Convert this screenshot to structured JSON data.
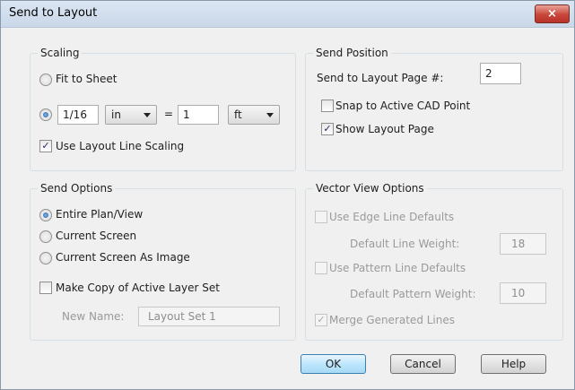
{
  "window": {
    "title": "Send to Layout",
    "close_glyph": "×"
  },
  "scaling": {
    "legend": "Scaling",
    "fit_to_sheet": "Fit to Sheet",
    "scale_left": "1/16",
    "left_unit": "in",
    "equals": "=",
    "scale_right": "1",
    "right_unit": "ft",
    "use_layout_line_scaling": "Use Layout Line Scaling"
  },
  "send_position": {
    "legend": "Send Position",
    "page_label": "Send to Layout Page #:",
    "page_value": "2",
    "snap_label": "Snap to Active CAD Point",
    "show_layout_label": "Show Layout Page"
  },
  "send_options": {
    "legend": "Send Options",
    "entire_plan": "Entire Plan/View",
    "current_screen": "Current Screen",
    "current_screen_image": "Current Screen As Image",
    "make_copy": "Make Copy of Active Layer Set",
    "new_name_label": "New Name:",
    "new_name_value": "Layout Set 1"
  },
  "vector_view": {
    "legend": "Vector View Options",
    "edge_defaults": "Use Edge Line Defaults",
    "default_line_weight_label": "Default Line Weight:",
    "default_line_weight": "18",
    "pattern_defaults": "Use Pattern Line Defaults",
    "default_pattern_weight_label": "Default Pattern Weight:",
    "default_pattern_weight": "10",
    "merge_lines": "Merge Generated Lines"
  },
  "buttons": {
    "ok": "OK",
    "cancel": "Cancel",
    "help": "Help"
  },
  "check_glyph": "✓"
}
